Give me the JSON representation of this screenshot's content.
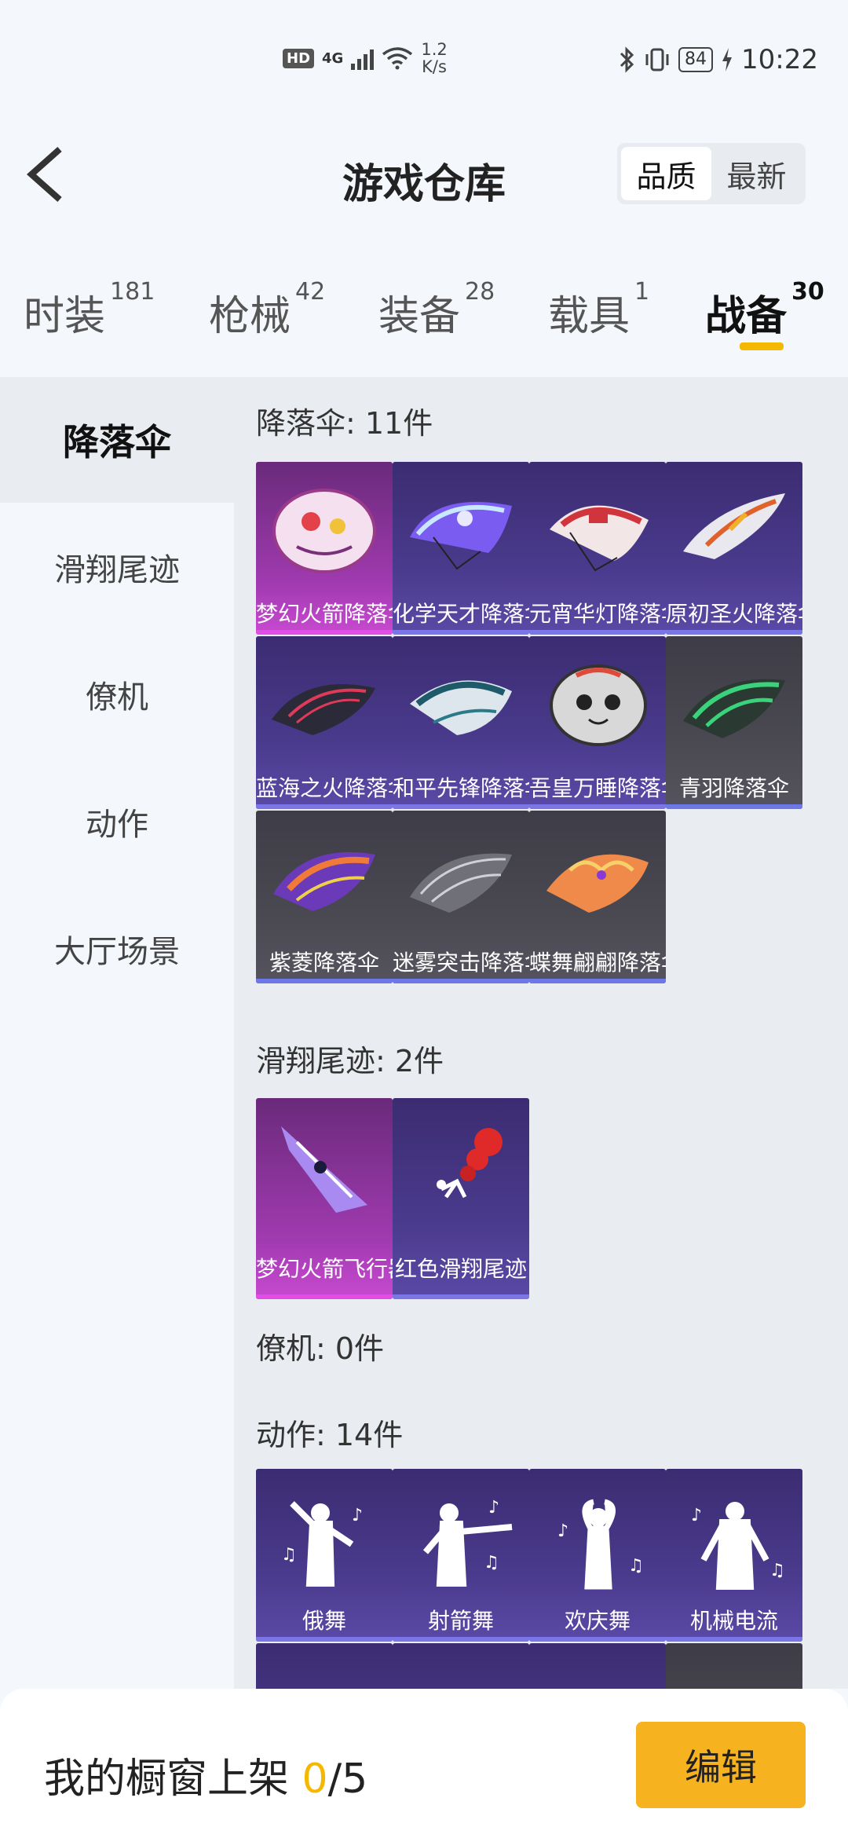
{
  "status": {
    "hd": "HD",
    "net": "4G",
    "speed_value": "1.2",
    "speed_unit": "K/s",
    "battery": "84",
    "time": "10:22"
  },
  "header": {
    "title": "游戏仓库",
    "sort_quality": "品质",
    "sort_latest": "最新"
  },
  "tabs": [
    {
      "label": "时装",
      "count": "181"
    },
    {
      "label": "枪械",
      "count": "42"
    },
    {
      "label": "装备",
      "count": "28"
    },
    {
      "label": "载具",
      "count": "1"
    },
    {
      "label": "战备",
      "count": "30"
    }
  ],
  "sidebar": {
    "items": [
      "降落伞",
      "滑翔尾迹",
      "僚机",
      "动作",
      "大厅场景"
    ]
  },
  "sections": {
    "parachute": {
      "title": "降落伞: 11件",
      "items": [
        "梦幻火箭降落伞",
        "化学天才降落伞",
        "元宵华灯降落伞",
        "原初圣火降落伞",
        "蓝海之火降落伞",
        "和平先锋降落伞",
        "吾皇万睡降落伞",
        "青羽降落伞",
        "紫菱降落伞",
        "迷雾突击降落伞",
        "蝶舞翩翩降落伞"
      ]
    },
    "trail": {
      "title": "滑翔尾迹: 2件",
      "items": [
        "梦幻火箭飞行器",
        "红色滑翔尾迹"
      ]
    },
    "wingman": {
      "title": "僚机: 0件"
    },
    "emote": {
      "title": "动作: 14件",
      "items": [
        "俄舞",
        "射箭舞",
        "欢庆舞",
        "机械电流"
      ]
    }
  },
  "bottom": {
    "shelf_label": "我的橱窗上架 ",
    "shelf_count": "0",
    "shelf_total": "/5",
    "edit": "编辑"
  },
  "colors": {
    "accent": "#f5b800",
    "button": "#f6b31f"
  }
}
